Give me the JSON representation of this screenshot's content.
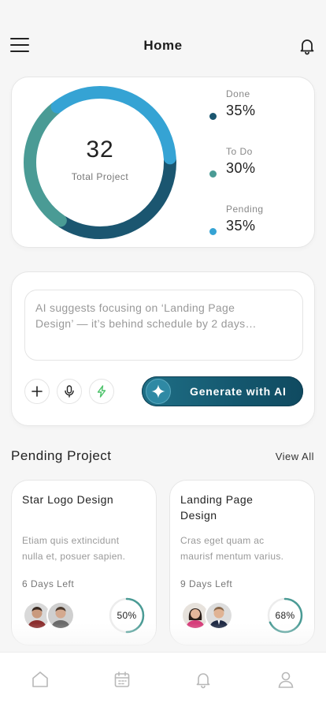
{
  "header": {
    "title": "Home"
  },
  "stats": {
    "total_value": "32",
    "total_label": "Total Project",
    "legend": [
      {
        "label": "Done",
        "value": "35%",
        "color": "#1b5670"
      },
      {
        "label": "To Do",
        "value": "30%",
        "color": "#4a9b95"
      },
      {
        "label": "Pending",
        "value": "35%",
        "color": "#35a3d4"
      }
    ]
  },
  "ai": {
    "suggestion_line1": "AI suggests focusing on ‘Landing Page",
    "suggestion_line2": "Design’ — it’s behind schedule by 2 days…",
    "generate_label": "Generate with AI",
    "attach_icon": "plus-icon",
    "voice_icon": "microphone-icon",
    "quick_icon": "lightning-icon"
  },
  "pending": {
    "title": "Pending Project",
    "view_all": "View All",
    "projects": [
      {
        "title": "Star Logo Design",
        "desc_line1": "Etiam quis extincidunt",
        "desc_line2": "nulla et, posuer sapien.",
        "days_left": "6 Days Left",
        "progress_label": "50%",
        "progress": 0.5
      },
      {
        "title": "Landing Page Design",
        "desc_line1": "Cras eget quam ac",
        "desc_line2": "maurisf mentum varius.",
        "days_left": "9 Days Left",
        "progress_label": "68%",
        "progress": 0.68
      }
    ]
  },
  "nav": {
    "items": [
      {
        "icon": "home-icon"
      },
      {
        "icon": "calendar-icon"
      },
      {
        "icon": "bell-icon"
      },
      {
        "icon": "profile-icon"
      }
    ]
  },
  "colors": {
    "accent": "#1b5670",
    "teal": "#4a9b95",
    "sky": "#35a3d4",
    "button": "#14576e"
  }
}
